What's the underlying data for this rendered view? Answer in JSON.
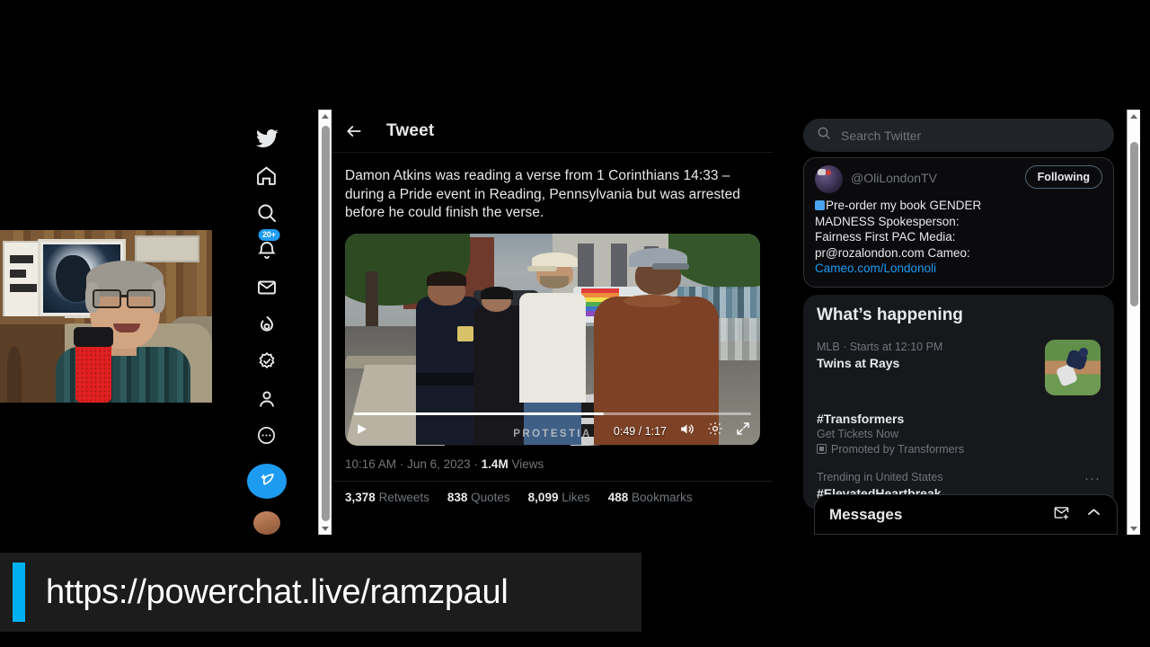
{
  "app": {
    "name": "Twitter"
  },
  "nav": {
    "items": [
      {
        "name": "twitter-logo",
        "label": "Twitter"
      },
      {
        "name": "home",
        "label": "Home"
      },
      {
        "name": "explore",
        "label": "Explore"
      },
      {
        "name": "notifications",
        "label": "Notifications",
        "badge": "20+"
      },
      {
        "name": "messages",
        "label": "Messages"
      },
      {
        "name": "grok",
        "label": "Grok"
      },
      {
        "name": "verified",
        "label": "Verified"
      },
      {
        "name": "profile",
        "label": "Profile"
      },
      {
        "name": "more",
        "label": "More"
      }
    ],
    "compose_label": "Tweet"
  },
  "header": {
    "title": "Tweet",
    "back_label": "Back"
  },
  "tweet": {
    "text": "Damon Atkins was reading a verse from 1 Corinthians 14:33 – during a Pride event in Reading, Pennsylvania but was arrested before he could finish the verse.",
    "timestamp": "10:16 AM",
    "date": "Jun 6, 2023",
    "views_count": "1.4M",
    "views_label": "Views",
    "separator": "·",
    "stats": [
      {
        "count": "3,378",
        "label": "Retweets"
      },
      {
        "count": "838",
        "label": "Quotes"
      },
      {
        "count": "8,099",
        "label": "Likes"
      },
      {
        "count": "488",
        "label": "Bookmarks"
      }
    ]
  },
  "video": {
    "current_time": "0:49",
    "duration": "1:17",
    "time_display": "0:49 / 1:17",
    "progress_percent": 63,
    "watermark": "PROTESTIA",
    "play_label": "Play",
    "mute_label": "Mute",
    "settings_label": "Settings",
    "fullscreen_label": "Full screen"
  },
  "search": {
    "placeholder": "Search Twitter"
  },
  "profile_card": {
    "handle": "@OliLondonTV",
    "follow_label": "Following",
    "bio_line1": "Pre-order my book GENDER",
    "bio_line2": "MADNESS  Spokesperson:",
    "bio_line3": "Fairness First PAC  Media:",
    "bio_line4": "pr@rozalondon.com Cameo:",
    "bio_link": "Cameo.com/Londonoli"
  },
  "whats_happening": {
    "title": "What’s happening",
    "items": [
      {
        "category": "MLB · Starts at 12:10 PM",
        "title": "Twins at Rays",
        "has_thumb": true
      },
      {
        "title": "#Transformers",
        "subtitle": "Get Tickets Now",
        "promoted": "Promoted by Transformers"
      },
      {
        "category": "Trending in United States",
        "title": "#ElevatedHeartbreak",
        "more_label": "More"
      }
    ]
  },
  "messages_dock": {
    "title": "Messages",
    "new_message_label": "New message",
    "expand_label": "Expand"
  },
  "overlay": {
    "url": "https://powerchat.live/ramzpaul",
    "accent_color": "#00b0f0"
  },
  "colors": {
    "brand_blue": "#1d9bf0",
    "background": "#000000",
    "panel": "#16181c",
    "text_primary": "#e7e9ea",
    "text_secondary": "#71767b"
  }
}
